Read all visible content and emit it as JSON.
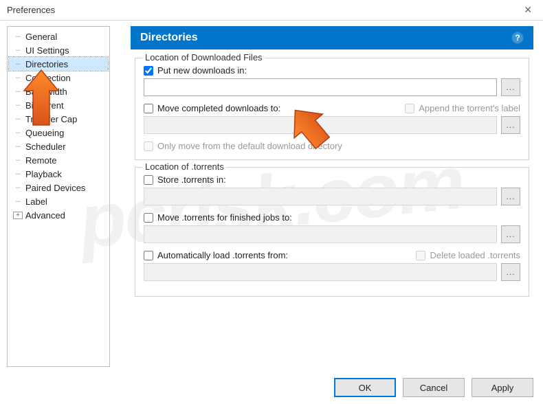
{
  "window": {
    "title": "Preferences",
    "close_glyph": "✕"
  },
  "sidebar": {
    "items": [
      {
        "label": "General"
      },
      {
        "label": "UI Settings"
      },
      {
        "label": "Directories",
        "selected": true
      },
      {
        "label": "Connection"
      },
      {
        "label": "Bandwidth"
      },
      {
        "label": "BitTorrent"
      },
      {
        "label": "Transfer Cap"
      },
      {
        "label": "Queueing"
      },
      {
        "label": "Scheduler"
      },
      {
        "label": "Remote"
      },
      {
        "label": "Playback"
      },
      {
        "label": "Paired Devices"
      },
      {
        "label": "Label"
      },
      {
        "label": "Advanced",
        "expander": "+"
      }
    ]
  },
  "header": {
    "title": "Directories",
    "help_glyph": "?"
  },
  "group_downloads": {
    "title": "Location of Downloaded Files",
    "put_new": {
      "label": "Put new downloads in:",
      "checked": true,
      "value": ""
    },
    "move_completed": {
      "label": "Move completed downloads to:",
      "checked": false,
      "value": ""
    },
    "append_label": {
      "label": "Append the torrent's label",
      "checked": false
    },
    "only_move": {
      "label": "Only move from the default download directory",
      "checked": false
    }
  },
  "group_torrents": {
    "title": "Location of .torrents",
    "store": {
      "label": "Store .torrents in:",
      "checked": false,
      "value": ""
    },
    "move_finished": {
      "label": "Move .torrents for finished jobs to:",
      "checked": false,
      "value": ""
    },
    "autoload": {
      "label": "Automatically load .torrents from:",
      "checked": false,
      "value": ""
    },
    "delete_loaded": {
      "label": "Delete loaded .torrents",
      "checked": false
    }
  },
  "footer": {
    "ok": "OK",
    "cancel": "Cancel",
    "apply": "Apply"
  },
  "browse_glyph": "...",
  "watermark": "pcrisk.com"
}
